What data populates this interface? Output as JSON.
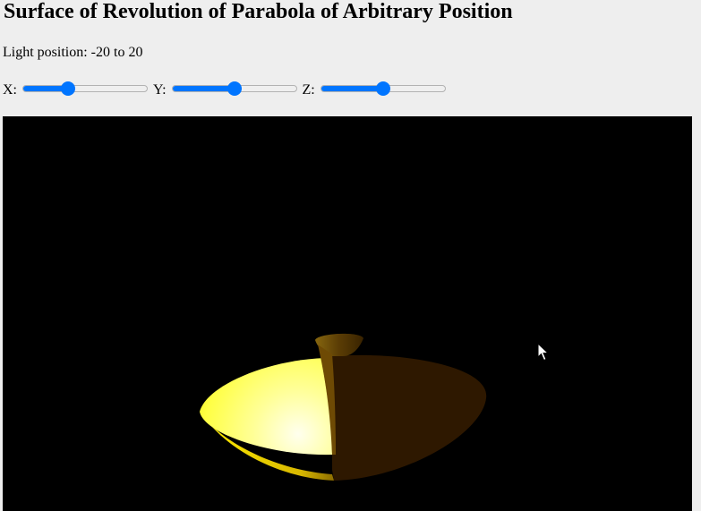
{
  "page": {
    "title": "Surface of Revolution of Parabola of Arbitrary Position",
    "light_label": "Light position: -20 to 20"
  },
  "controls": {
    "range": [
      -20,
      20
    ],
    "sliders": [
      {
        "id": "x",
        "label": "X:",
        "value": -6
      },
      {
        "id": "y",
        "label": "Y:",
        "value": 0
      },
      {
        "id": "z",
        "label": "Z:",
        "value": 0
      }
    ],
    "accent_color": "#0075ff"
  },
  "scene": {
    "background": "#000000",
    "lit_color": "#ffff66",
    "shadow_color": "#2e1800"
  }
}
